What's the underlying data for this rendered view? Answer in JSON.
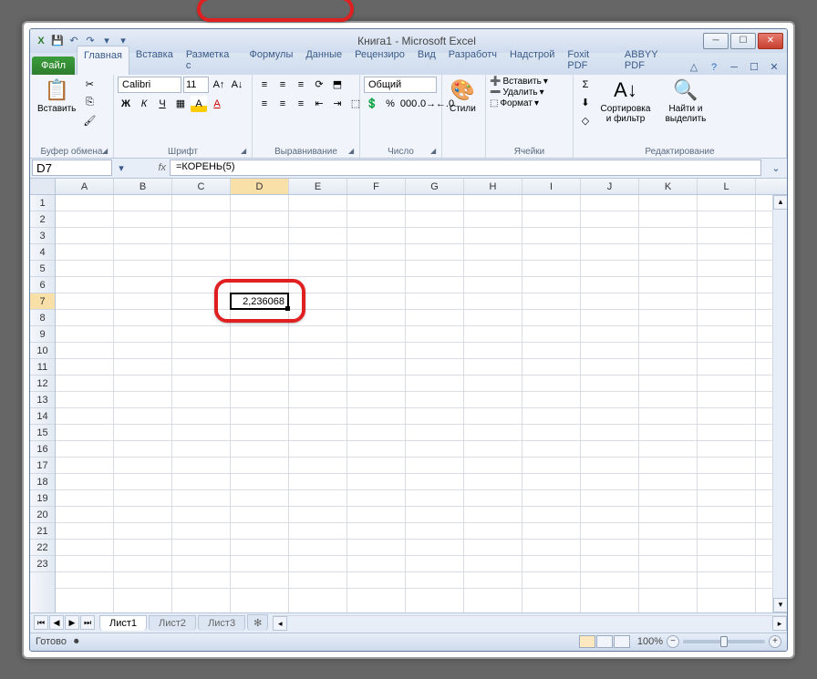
{
  "window": {
    "title": "Книга1 - Microsoft Excel"
  },
  "qat": {
    "excel_icon": "X",
    "save": "💾",
    "undo": "↶",
    "redo": "↷"
  },
  "tabs": {
    "file": "Файл",
    "items": [
      "Главная",
      "Вставка",
      "Разметка с",
      "Формулы",
      "Данные",
      "Рецензиро",
      "Вид",
      "Разработч",
      "Надстрой",
      "Foxit PDF",
      "ABBYY PDF"
    ],
    "active_index": 0
  },
  "ribbon": {
    "clipboard": {
      "paste": "Вставить",
      "label": "Буфер обмена"
    },
    "font": {
      "name": "Calibri",
      "size": "11",
      "label": "Шрифт"
    },
    "alignment": {
      "label": "Выравнивание"
    },
    "number": {
      "format": "Общий",
      "label": "Число"
    },
    "styles": {
      "btn": "Стили",
      "label": ""
    },
    "cells": {
      "insert": "Вставить",
      "delete": "Удалить",
      "format": "Формат",
      "label": "Ячейки"
    },
    "editing": {
      "sort": "Сортировка и фильтр",
      "find": "Найти и выделить",
      "label": "Редактирование"
    }
  },
  "formula_bar": {
    "name_box": "D7",
    "formula": "=КОРЕНЬ(5)"
  },
  "grid": {
    "columns": [
      "A",
      "B",
      "C",
      "D",
      "E",
      "F",
      "G",
      "H",
      "I",
      "J",
      "K",
      "L"
    ],
    "row_count": 23,
    "selected_col": "D",
    "selected_row": 7,
    "cell_value": "2,236068"
  },
  "sheets": {
    "tabs": [
      "Лист1",
      "Лист2",
      "Лист3"
    ],
    "active_index": 0
  },
  "status": {
    "ready": "Готово",
    "zoom": "100%"
  }
}
